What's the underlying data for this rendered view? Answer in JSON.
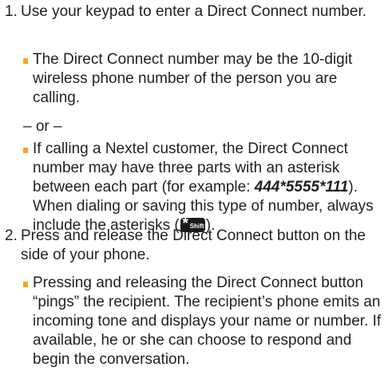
{
  "steps": [
    {
      "number": "1.",
      "text": "Use your keypad to enter a Direct Connect number.",
      "bullets": [
        "The Direct Connect number may be the 10-digit wireless phone number of the person you are calling."
      ],
      "separator": "– or –",
      "bullet2_before": "If calling a Nextel customer, the Direct Connect number may have three parts with an asterisk between each part (for example: ",
      "bullet2_example": "444*5555*111",
      "bullet2_after": "). When dialing or saving this type of number, always include the asterisks (",
      "bullet2_end": ").",
      "key_icon": {
        "star": "*",
        "label": "Shift"
      }
    },
    {
      "number": "2.",
      "text": "Press and release the Direct Connect button on the side of your phone.",
      "bullets": [
        "Pressing and releasing the Direct Connect button “pings” the recipient. The recipient’s phone emits an incoming tone and displays your name or number. If available, he or she can choose to respond and begin the conversation."
      ]
    }
  ],
  "colors": {
    "bullet": "#f6a623",
    "text": "#231f20",
    "key": "#1a1a1a"
  }
}
